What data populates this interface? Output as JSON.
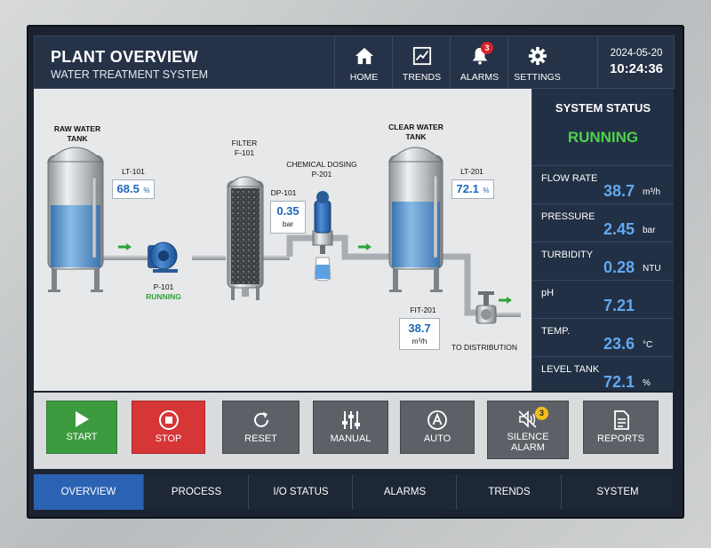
{
  "header": {
    "title": "PLANT OVERVIEW",
    "subtitle": "WATER TREATMENT SYSTEM",
    "nav": [
      {
        "label": "HOME",
        "icon": "home-icon"
      },
      {
        "label": "TRENDS",
        "icon": "trend-chart-icon"
      },
      {
        "label": "ALARMS",
        "icon": "bell-icon",
        "badge": "3"
      },
      {
        "label": "SETTINGS",
        "icon": "gear-icon"
      }
    ],
    "date": "2024-05-20",
    "time": "10:24:36"
  },
  "process": {
    "raw_tank": {
      "label_line1": "RAW WATER",
      "label_line2": "TANK",
      "level_tag": "LT-101",
      "level_value": "68.5",
      "level_unit": "%"
    },
    "pump": {
      "tag": "P-101",
      "state": "RUNNING"
    },
    "filter": {
      "label_line1": "FILTER",
      "label_line2": "F-101",
      "dp_tag": "DP-101",
      "dp_value": "0.35",
      "dp_unit": "bar"
    },
    "dosing": {
      "label_line1": "CHEMICAL DOSING",
      "label_line2": "P-201"
    },
    "clear_tank": {
      "label_line1": "CLEAR WATER",
      "label_line2": "TANK",
      "level_tag": "LT-201",
      "level_value": "72.1",
      "level_unit": "%"
    },
    "flow": {
      "tag": "FIT-201",
      "value": "38.7",
      "unit": "m³/h"
    },
    "outlet_label": "TO DISTRIBUTION"
  },
  "system_status": {
    "title": "SYSTEM STATUS",
    "state": "RUNNING",
    "rows": [
      {
        "name": "FLOW RATE",
        "value": "38.7",
        "unit": "m³/h"
      },
      {
        "name": "PRESSURE",
        "value": "2.45",
        "unit": "bar"
      },
      {
        "name": "TURBIDITY",
        "value": "0.28",
        "unit": "NTU"
      },
      {
        "name": "pH",
        "value": "7.21",
        "unit": ""
      },
      {
        "name": "TEMP.",
        "value": "23.6",
        "unit": "°C"
      },
      {
        "name": "LEVEL TANK",
        "value": "72.1",
        "unit": "%"
      }
    ]
  },
  "actions": [
    {
      "label": "START",
      "icon": "play-icon"
    },
    {
      "label": "STOP",
      "icon": "stop-icon"
    },
    {
      "label": "RESET",
      "icon": "reset-icon"
    },
    {
      "label": "MANUAL",
      "icon": "sliders-icon"
    },
    {
      "label": "AUTO",
      "icon": "auto-icon"
    },
    {
      "label": "SILENCE ALARM",
      "icon": "mute-speaker-icon",
      "badge": "3"
    },
    {
      "label": "REPORTS",
      "icon": "document-icon"
    }
  ],
  "tabs": [
    "OVERVIEW",
    "PROCESS",
    "I/O STATUS",
    "ALARMS",
    "TRENDS",
    "SYSTEM"
  ],
  "colors": {
    "accent": "#2b63b2",
    "running": "#4cd34c",
    "start": "#3d9b3f",
    "stop": "#d63636",
    "alarm_badge": "#d8232a"
  }
}
